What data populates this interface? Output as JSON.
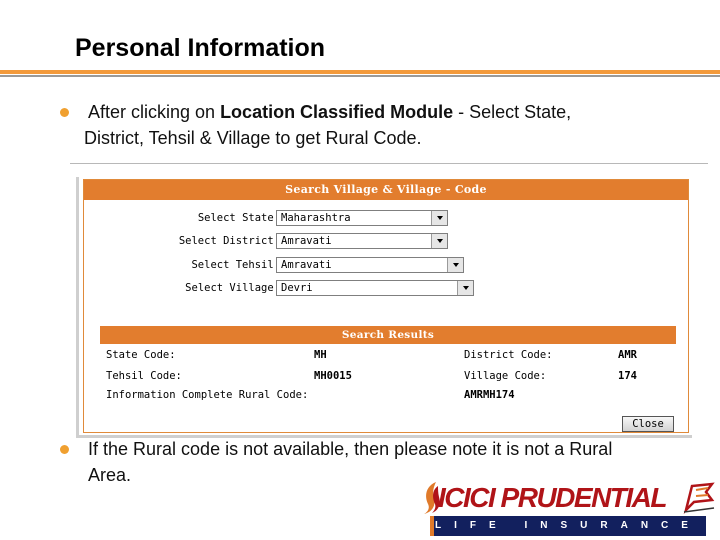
{
  "slide": {
    "title": "Personal Information",
    "bullet1_pre": "After clicking on ",
    "bullet1_bold": "Location Classified Module",
    "bullet1_post": " - Select State,",
    "bullet1_line2": "District, Tehsil & Village to get Rural Code.",
    "bullet2_line1": "If the Rural code is not available, then please note it is not a Rural",
    "bullet2_line2": "Area."
  },
  "search_panel": {
    "title": "Search Village & Village - Code",
    "fields": [
      {
        "label": "Select State:",
        "value": "Maharashtra"
      },
      {
        "label": "Select District:",
        "value": "Amravati"
      },
      {
        "label": "Select Tehsil:",
        "value": "Amravati"
      },
      {
        "label": "Select Village:",
        "value": "Devri"
      }
    ]
  },
  "results": {
    "title": "Search Results",
    "state_code_label": "State Code:",
    "state_code_value": "MH",
    "district_code_label": "District Code:",
    "district_code_value": "AMR",
    "tehsil_code_label": "Tehsil Code:",
    "tehsil_code_value": "MH0015",
    "village_code_label": "Village Code:",
    "village_code_value": "174",
    "complete_label": "Information Complete Rural Code:",
    "complete_value": "AMRMH174"
  },
  "close_label": "Close",
  "logo": {
    "brand": "ICICI PRUDENTIAL",
    "tagline": "LIFE INSURANCE",
    "colors": {
      "red": "#b01418",
      "navy": "#12205e",
      "orange": "#e07a2a"
    }
  },
  "colors": {
    "panel_header": "#e27d2e",
    "bullet": "#f0a030",
    "title_rule": "#f39a3b"
  }
}
